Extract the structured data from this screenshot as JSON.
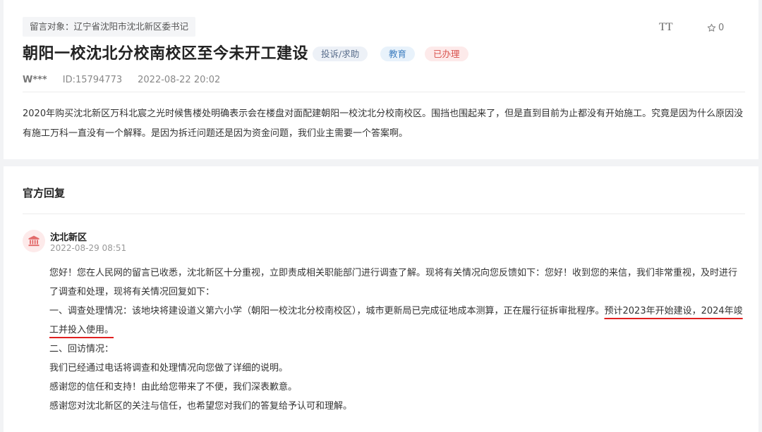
{
  "message": {
    "target": "留言对象：辽宁省沈阳市沈北新区委书记",
    "font_toggle": "TT",
    "fav_count": "0",
    "title": "朝阳一校沈北分校南校区至今未开工建设",
    "tags": [
      "投诉/求助",
      "教育",
      "已办理"
    ],
    "user": "W***",
    "id": "ID:15794773",
    "date": "2022-08-22 20:02",
    "content": "2020年购买沈北新区万科北宸之光时候售楼处明确表示会在楼盘对面配建朝阳一校沈北分校南校区。围挡也围起来了，但是直到目前为止都没有开始施工。究竟是因为什么原因没有施工万科一直没有一个解释。是因为拆迁问题还是因为资金问题，我们业主需要一个答案啊。"
  },
  "reply": {
    "section_title": "官方回复",
    "org": "沈北新区",
    "time": "2022-08-29 08:51",
    "p1": "您好！您在人民网的留言已收悉，沈北新区十分重视，立即责成相关职能部门进行调查了解。现将有关情况向您反馈如下：您好！收到您的来信，我们非常重视，及时进行了调查和处理，现将有关情况回复如下：",
    "p2_prefix": "一、调查处理情况：该地块将建设道义第六小学（朝阳一校沈北分校南校区），城市更新局已完成征地成本测算，正在履行征拆审批程序。",
    "p2_highlight": "预计2023年开始建设，2024年竣工并投入使用。",
    "p3": "二、回访情况：",
    "p4": "我们已经通过电话将调查和处理情况向您做了详细的说明。",
    "p5": "感谢您的信任和支持！由此给您带来了不便，我们深表歉意。",
    "p6": "感谢您对沈北新区的关注与信任，也希望您对我们的答复给予认可和理解。"
  },
  "colors": {
    "accent_red": "#e02020",
    "badge_red": "#d9534f",
    "badge_blue": "#3f7fc0"
  },
  "icons": [
    "font-size-icon",
    "star-icon",
    "government-building-icon"
  ]
}
